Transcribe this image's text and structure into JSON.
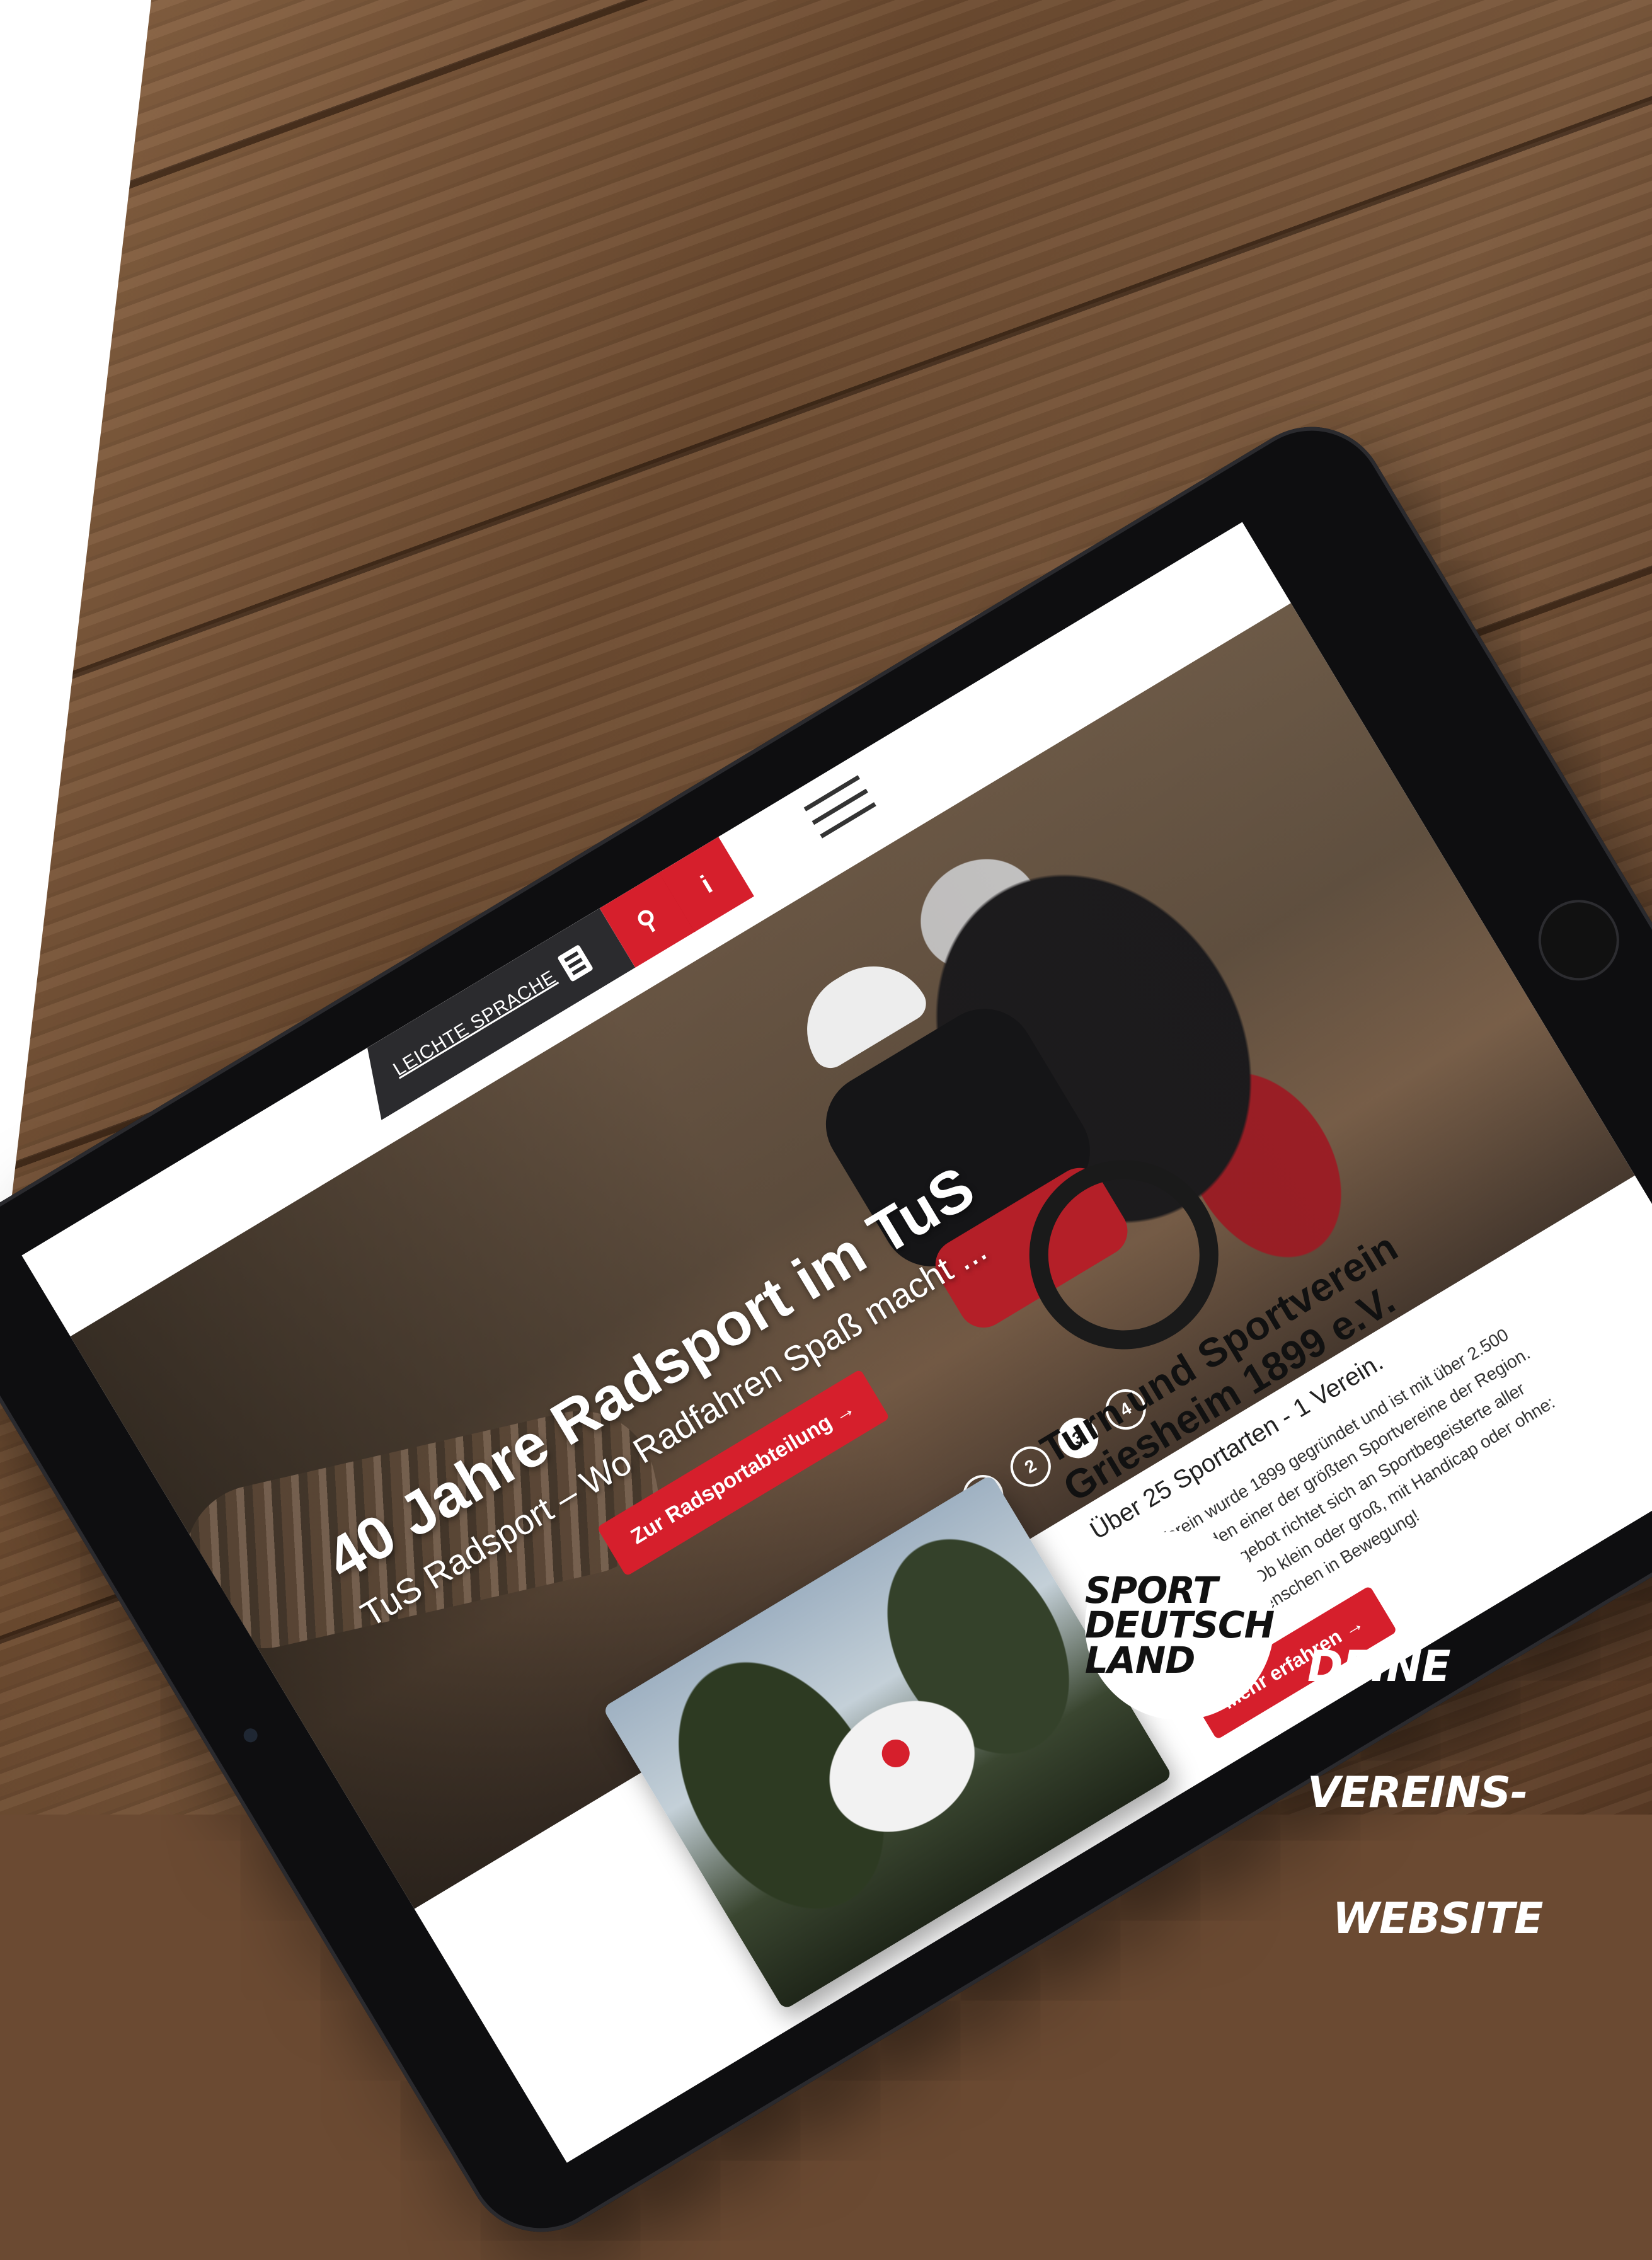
{
  "header": {
    "easy_language_label": "LEICHTE SPRACHE",
    "search_icon_glyph": "⚲",
    "info_icon_glyph": "i"
  },
  "hero": {
    "title": "40 Jahre Radsport im TuS",
    "subtitle": "TuS Radsport – Wo Radfahren Spaß macht ...",
    "cta_label": "Zur Radsportabteilung →",
    "slides": [
      "1",
      "2",
      "3",
      "4"
    ],
    "active_slide": "3"
  },
  "intro": {
    "heading": "Turn und Sportverein Griesheim 1899 e.V.",
    "tagline": "Über 25 Sportarten - 1 Verein.",
    "body": "Unser Verein wurde 1899 gegründet und ist mit über 2.500 Sporttreibenden einer der größten Sportvereine der Region. Unser Sportangebot richtet sich an Sportbegeisterte aller Altersklassen. Ob klein oder groß, mit Handicap oder ohne: Wir bringen Menschen in Bewegung!",
    "cta_label": "Mehr erfahren →"
  },
  "branding": {
    "sport_logo_line1": "SPORT",
    "sport_logo_line2": "DEUTSCH",
    "sport_logo_line3": "LAND",
    "tagline_line1": "DEINE",
    "tagline_line2": "VEREINS-",
    "tagline_line3": "WEBSITE"
  },
  "colors": {
    "accent": "#d61f2c",
    "dark": "#2b2b2e"
  },
  "icons": [
    "book-icon",
    "search-icon",
    "info-icon",
    "menu-icon"
  ]
}
